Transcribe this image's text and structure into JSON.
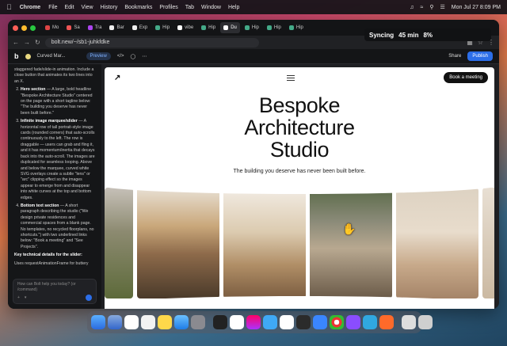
{
  "menubar": {
    "app_name": "Chrome",
    "items": [
      "File",
      "Edit",
      "View",
      "History",
      "Bookmarks",
      "Profiles",
      "Tab",
      "Window",
      "Help"
    ],
    "clock": "Mon Jul 27  8:09 PM"
  },
  "browser": {
    "tabs": [
      "Mo",
      "Sa",
      "Tra",
      "Bar",
      "Exp",
      "Hip",
      "vibe",
      "Hip",
      "Du",
      "Hip",
      "Hip",
      "Hip"
    ],
    "active_tab": "Du",
    "url": "bolt.new/~/sb1-juhkfdke",
    "sync_popup": {
      "label": "Syncing",
      "time": "45 min",
      "percent": "8%"
    }
  },
  "bolt": {
    "project_title": "Curved Mar...",
    "preview_label": "Preview",
    "share_label": "Share",
    "publish_label": "Publish"
  },
  "chat": {
    "intro": "staggered fade/slide-in animation. Include a close button that animates its two lines into an X.",
    "items": [
      {
        "title": "Hero section",
        "text": " — A large, bold headline \"Bespoke Architecture Studio\" centered on the page with a short tagline below: \"The building you deserve has never been built before.\""
      },
      {
        "title": "Infinite image marquee/slider",
        "text": " — A horizontal row of tall portrait-style image cards (rounded corners) that auto-scrolls continuously to the left. The row is draggable — users can grab and fling it, and it has momentum/inertia that decays back into the auto-scroll. The images are duplicated for seamless looping. Above and below the marquee, curved white SVG overlays create a subtle \"lens\" or \"arc\" clipping effect so the images appear to emerge from and disappear into white curves at the top and bottom edges."
      },
      {
        "title": "Bottom text section",
        "text": " — A short paragraph describing the studio (\"We design private residences and commercial spaces from a blank page. No templates, no recycled floorplans, no shortcuts.\") with two underlined links below: \"Book a meeting\" and \"See Projects\"."
      }
    ],
    "key_details_title": "Key technical details for the slider:",
    "key_detail": "Uses requestAnimationFrame for buttery",
    "input_placeholder": "How can Bolt help you today? (or /command)"
  },
  "site": {
    "book_button": "Book a meeting",
    "headline_line1": "Bespoke",
    "headline_line2": "Architecture",
    "headline_line3": "Studio",
    "tagline": "The building you deserve has never been built before."
  },
  "colors": {
    "menubar_bg": "#141418",
    "publish": "#2c6ee8",
    "window_bg": "#1e1f22",
    "preview_bg": "#ffffff"
  }
}
